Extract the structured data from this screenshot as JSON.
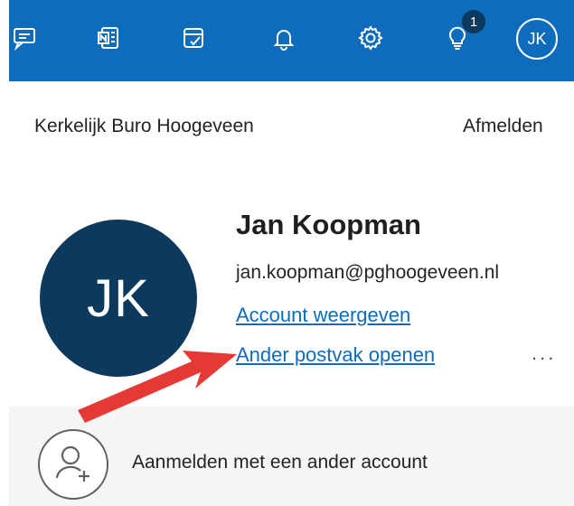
{
  "topbar": {
    "icons": [
      "chat-icon",
      "onenote-icon",
      "todo-icon",
      "bell-icon",
      "gear-icon",
      "lightbulb-icon"
    ],
    "tips_badge": "1",
    "avatar_initials": "JK",
    "accent_color": "#0f6cbd"
  },
  "account": {
    "organization": "Kerkelijk Buro Hoogeveen",
    "sign_out": "Afmelden",
    "avatar_initials": "JK",
    "name": "Jan Koopman",
    "email": "jan.koopman@pghoogeveen.nl",
    "view_account": "Account weergeven",
    "open_other_mailbox": "Ander postvak openen",
    "more": "..."
  },
  "footer": {
    "sign_in_other": "Aanmelden met een ander account"
  },
  "annotation": {
    "arrow_color": "#e53935"
  }
}
